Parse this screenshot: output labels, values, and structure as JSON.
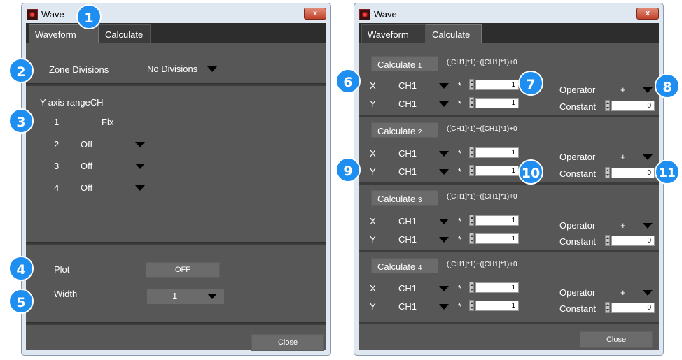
{
  "left_window": {
    "title": "Wave",
    "close_glyph": "x",
    "tabs": [
      "Waveform",
      "Calculate"
    ],
    "zone_divisions": {
      "label": "Zone Divisions",
      "value": "No Divisions"
    },
    "y_axis": {
      "header": "Y-axis rangeCH",
      "rows": [
        {
          "ch": "1",
          "value": "Fix"
        },
        {
          "ch": "2",
          "value": "Off"
        },
        {
          "ch": "3",
          "value": "Off"
        },
        {
          "ch": "4",
          "value": "Off"
        }
      ]
    },
    "plot": {
      "label": "Plot",
      "value": "OFF"
    },
    "width": {
      "label": "Width",
      "value": "1"
    },
    "close_label": "Close"
  },
  "right_window": {
    "title": "Wave",
    "close_glyph": "x",
    "tabs": [
      "Waveform",
      "Calculate"
    ],
    "calcs": [
      {
        "name": "Calculate",
        "num": "1",
        "formula": "([CH1]*1)+([CH1]*1)+0",
        "x_label": "X",
        "x_ch": "CH1",
        "x_mult": "1",
        "y_label": "Y",
        "y_ch": "CH1",
        "y_mult": "1",
        "op_label": "Operator",
        "op_value": "+",
        "const_label": "Constant",
        "const_value": "0",
        "star": "*"
      },
      {
        "name": "Calculate",
        "num": "2",
        "formula": "([CH1]*1)+([CH1]*1)+0",
        "x_label": "X",
        "x_ch": "CH1",
        "x_mult": "1",
        "y_label": "Y",
        "y_ch": "CH1",
        "y_mult": "1",
        "op_label": "Operator",
        "op_value": "+",
        "const_label": "Constant",
        "const_value": "0",
        "star": "*"
      },
      {
        "name": "Calculate",
        "num": "3",
        "formula": "([CH1]*1)+([CH1]*1)+0",
        "x_label": "X",
        "x_ch": "CH1",
        "x_mult": "1",
        "y_label": "Y",
        "y_ch": "CH1",
        "y_mult": "1",
        "op_label": "Operator",
        "op_value": "+",
        "const_label": "Constant",
        "const_value": "0",
        "star": "*"
      },
      {
        "name": "Calculate",
        "num": "4",
        "formula": "([CH1]*1)+([CH1]*1)+0",
        "x_label": "X",
        "x_ch": "CH1",
        "x_mult": "1",
        "y_label": "Y",
        "y_ch": "CH1",
        "y_mult": "1",
        "op_label": "Operator",
        "op_value": "+",
        "const_label": "Constant",
        "const_value": "0",
        "star": "*"
      }
    ],
    "close_label": "Close"
  },
  "callouts": [
    "1",
    "2",
    "3",
    "4",
    "5",
    "6",
    "7",
    "8",
    "9",
    "10",
    "11"
  ],
  "colors": {
    "badge": "#1e8ef0",
    "panel": "#575757",
    "tabbar": "#2d2d2d",
    "window_frame": "#dfe7f1",
    "close_button": "#c2432b"
  }
}
